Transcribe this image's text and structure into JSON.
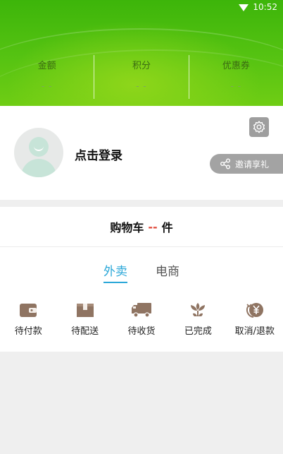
{
  "status_bar": {
    "time": "10:52"
  },
  "stats": [
    {
      "label": "金额",
      "value": "- -"
    },
    {
      "label": "积分",
      "value": "- -"
    },
    {
      "label": "优惠券",
      "value": "- -"
    }
  ],
  "profile": {
    "login_text": "点击登录",
    "invite_label": "邀请享礼"
  },
  "cart": {
    "prefix": "购物车",
    "count": "--",
    "suffix": "件"
  },
  "order_tabs": [
    {
      "label": "外卖",
      "active": true
    },
    {
      "label": "电商",
      "active": false
    }
  ],
  "order_items": [
    {
      "icon": "wallet-icon",
      "label": "待付款"
    },
    {
      "icon": "package-icon",
      "label": "待配送"
    },
    {
      "icon": "truck-icon",
      "label": "待收货"
    },
    {
      "icon": "flower-icon",
      "label": "已完成"
    },
    {
      "icon": "refund-yen-icon",
      "label": "取消/退款"
    }
  ],
  "colors": {
    "hero_green": "#56c312",
    "tab_active": "#2aa7d8",
    "cart_count": "#e0483a",
    "icon_brown": "#8f7462"
  }
}
